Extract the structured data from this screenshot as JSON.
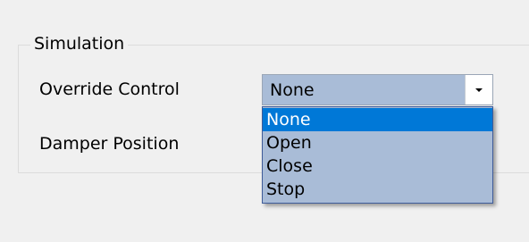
{
  "simulation_group": {
    "title": "Simulation",
    "override_control": {
      "label": "Override Control",
      "selected_value": "None",
      "dropdown_open": true,
      "options": [
        {
          "label": "None",
          "highlighted": true
        },
        {
          "label": "Open",
          "highlighted": false
        },
        {
          "label": "Close",
          "highlighted": false
        },
        {
          "label": "Stop",
          "highlighted": false
        }
      ]
    },
    "damper_position": {
      "label": "Damper Position"
    }
  },
  "icons": {
    "dropdown_arrow": "chevron-down-icon"
  },
  "colors": {
    "window_background": "#f0f0f0",
    "combo_fill": "#a9bcd7",
    "list_border": "#3f5c99",
    "highlight": "#0078d7",
    "highlight_text": "#ffffff"
  }
}
